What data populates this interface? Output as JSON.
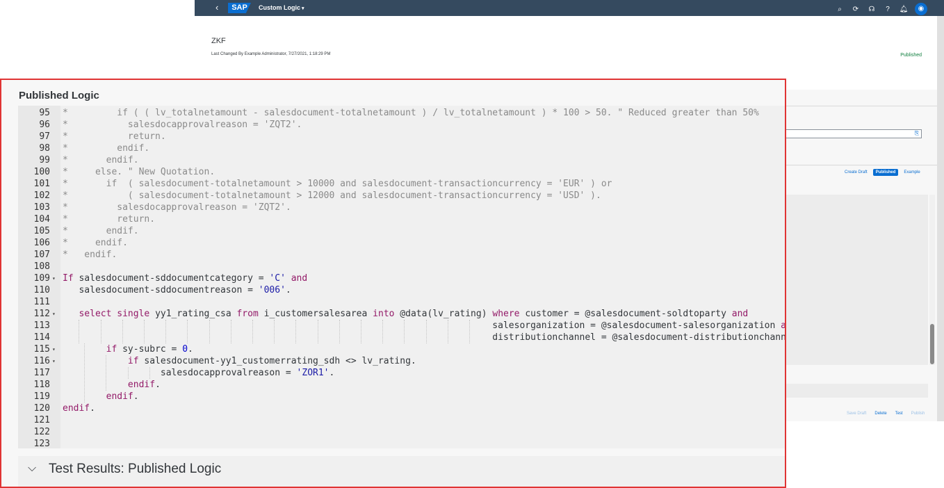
{
  "shell": {
    "back_icon": "‹",
    "logo": "SAP",
    "app_title": "Custom Logic",
    "icons": [
      "search-icon",
      "sync-icon",
      "feedback-icon",
      "help-icon",
      "bell-icon",
      "user-avatar"
    ]
  },
  "header": {
    "title": "ZKF",
    "last_changed": "Last Changed By Example Administrator, 7/27/2021, 1:18:29 PM",
    "status": "Published"
  },
  "toolbar": {
    "create_draft": "Create Draft",
    "published": "Published",
    "example": "Example"
  },
  "footer": {
    "save_draft": "Save Draft",
    "delete": "Delete",
    "test": "Test",
    "publish": "Publish"
  },
  "panel": {
    "title": "Published Logic",
    "results_title": "Test Results: Published Logic",
    "results_chevron": "⌵"
  },
  "code": {
    "lines": [
      {
        "n": "95",
        "text": "*         if ( ( lv_totalnetamount - salesdocument-totalnetamount ) / lv_totalnetamount ) * 100 > 50. \" Reduced greater than 50%"
      },
      {
        "n": "96",
        "text": "*           salesdocapprovalreason = 'ZQT2'."
      },
      {
        "n": "97",
        "text": "*           return."
      },
      {
        "n": "98",
        "text": "*         endif."
      },
      {
        "n": "99",
        "text": "*       endif."
      },
      {
        "n": "100",
        "text": "*     else. \" New Quotation."
      },
      {
        "n": "101",
        "text": "*       if  ( salesdocument-totalnetamount > 10000 and salesdocument-transactioncurrency = 'EUR' ) or"
      },
      {
        "n": "102",
        "text": "*           ( salesdocument-totalnetamount > 12000 and salesdocument-transactioncurrency = 'USD' )."
      },
      {
        "n": "103",
        "text": "*         salesdocapprovalreason = 'ZQT2'."
      },
      {
        "n": "104",
        "text": "*         return."
      },
      {
        "n": "105",
        "text": "*       endif."
      },
      {
        "n": "106",
        "text": "*     endif."
      },
      {
        "n": "107",
        "text": "*   endif."
      },
      {
        "n": "108",
        "text": ""
      },
      {
        "n": "109",
        "text": "If salesdocument-sddocumentcategory = 'C' and"
      },
      {
        "n": "110",
        "text": "   salesdocument-sddocumentreason = '006'."
      },
      {
        "n": "111",
        "text": ""
      },
      {
        "n": "112",
        "text": "   select single yy1_rating_csa from i_customersalesarea into @data(lv_rating) where customer = @salesdocument-soldtoparty and"
      },
      {
        "n": "113",
        "text": "                                                                               salesorganization = @salesdocument-salesorganization and"
      },
      {
        "n": "114",
        "text": "                                                                               distributionchannel = @salesdocument-distributionchannel."
      },
      {
        "n": "115",
        "text": "        if sy-subrc = 0."
      },
      {
        "n": "116",
        "text": "            if salesdocument-yy1_customerrating_sdh <> lv_rating."
      },
      {
        "n": "117",
        "text": "                  salesdocapprovalreason = 'ZOR1'."
      },
      {
        "n": "118",
        "text": "            endif."
      },
      {
        "n": "119",
        "text": "        endif."
      },
      {
        "n": "120",
        "text": "endif."
      },
      {
        "n": "121",
        "text": ""
      },
      {
        "n": "122",
        "text": ""
      },
      {
        "n": "123",
        "text": ""
      }
    ],
    "folds": [
      "109",
      "112",
      "115",
      "116"
    ]
  }
}
